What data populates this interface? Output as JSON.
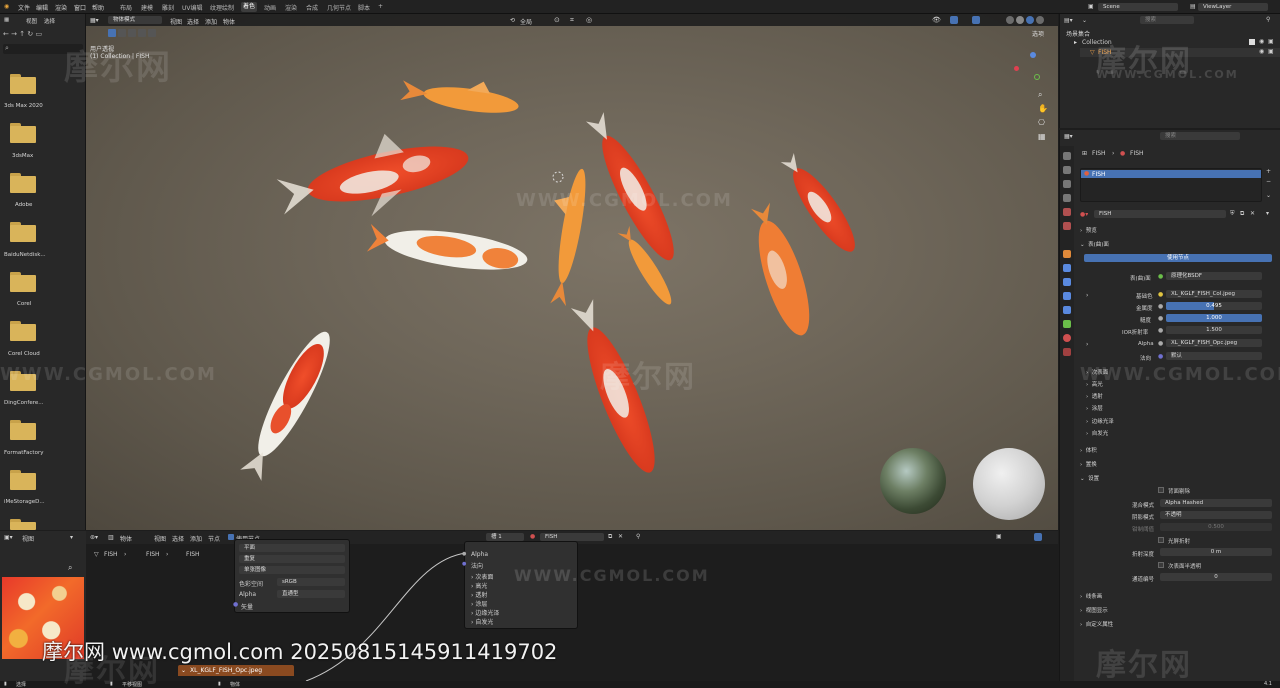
{
  "topmenu": {
    "items": [
      "文件",
      "编辑",
      "渲染",
      "窗口",
      "帮助"
    ],
    "workspaces": [
      "布局",
      "建模",
      "雕刻",
      "UV编辑",
      "纹理绘制",
      "着色",
      "动画",
      "渲染",
      "合成",
      "几何节点",
      "脚本"
    ],
    "active_workspace": "着色",
    "add_tab": "+",
    "scene": "Scene",
    "view_layer": "ViewLayer"
  },
  "file_browser": {
    "header": [
      "视图",
      "选择"
    ],
    "folders": [
      "3ds Max 2020",
      "3dsMax",
      "Adobe",
      "BaiduNetdisk...",
      "Corel",
      "Corel Cloud",
      "DingConfere...",
      "FormatFactory",
      "iMeStorageD..."
    ]
  },
  "viewport": {
    "mode": "物体模式",
    "menus": [
      "视图",
      "选择",
      "添加",
      "物体"
    ],
    "transform_orientation": "全局",
    "view_name": "用户透视",
    "collection_label": "(1) Collection | FISH",
    "options_label": "选项"
  },
  "outliner": {
    "title": "场景集合",
    "collection": "Collection",
    "object": "FISH",
    "search_placeholder": "搜索"
  },
  "properties": {
    "search_placeholder": "搜索",
    "breadcrumb_object": "FISH",
    "breadcrumb_material": "FISH",
    "slot_name": "FISH",
    "material_name": "FISH",
    "preview_label": "预览",
    "surface_label": "表(曲)面",
    "use_nodes": "使用节点",
    "rows": [
      {
        "label": "表(曲)面",
        "value": "原理化BSDF"
      },
      {
        "label": "基础色",
        "value": "XL_KGLF_FISH_Col.jpeg"
      },
      {
        "label": "金属度",
        "value": "0.495"
      },
      {
        "label": "糙度",
        "value": "1.000"
      },
      {
        "label": "IOR折射率",
        "value": "1.500"
      },
      {
        "label": "Alpha",
        "value": "XL_KGLF_FISH_Opc.jpeg"
      },
      {
        "label": "法向",
        "value": "默认"
      }
    ],
    "subsections": [
      "次表面",
      "高光",
      "透射",
      "涂层",
      "边缘光泽",
      "自发光"
    ],
    "volume": "体积",
    "displacement": "置换",
    "settings": "设置",
    "backface": "背面剔除",
    "blend_mode_label": "混合模式",
    "blend_mode": "Alpha Hashed",
    "shadow_mode_label": "阴影模式",
    "shadow_mode": "不透明",
    "clip_label": "钳制阈值",
    "clip_value": "0.500",
    "screen_refraction": "光屏折射",
    "refraction_depth_label": "折射深度",
    "refraction_depth": "0 m",
    "subsurface_translucency": "次表面半透明",
    "pass_index_label": "通道编号",
    "pass_index": "0",
    "line_art": "线条画",
    "viewport_display": "视图显示",
    "custom_props": "自定义属性"
  },
  "node_editor": {
    "header_menus": [
      "视图",
      "选择",
      "添加",
      "节点"
    ],
    "mode": "物体",
    "use_nodes": "使用节点",
    "slot": "槽 1",
    "material": "FISH",
    "breadcrumb": [
      "FISH",
      "FISH",
      "FISH"
    ],
    "image_node_rows": [
      "平面",
      "重复",
      "单张图像"
    ],
    "color_space_label": "色彩空间",
    "color_space": "sRGB",
    "alpha_label": "Alpha",
    "alpha_mode": "直通型",
    "vector_label": "矢量",
    "image_node_title": "XL_KGLF_FISH_Opc.jpeg",
    "bsdf_rows": [
      "Alpha",
      "法向",
      "次表面",
      "高光",
      "透射",
      "涂层",
      "边缘光泽",
      "自发光"
    ]
  },
  "image_editor": {
    "header": [
      "视图"
    ]
  },
  "statusbar": {
    "left": "选择",
    "middle": "平移视图",
    "right": "物体",
    "version": "4.1"
  },
  "watermark": {
    "url": "www.cgmol.com",
    "id": "20250815145911419702",
    "brand": "摩尔网",
    "domain_caps": "WWW.CGMOL.COM"
  },
  "colors": {
    "accent_blue": "#4772b3",
    "active_orange": "#f0a14a",
    "folder": "#d9b45a"
  }
}
